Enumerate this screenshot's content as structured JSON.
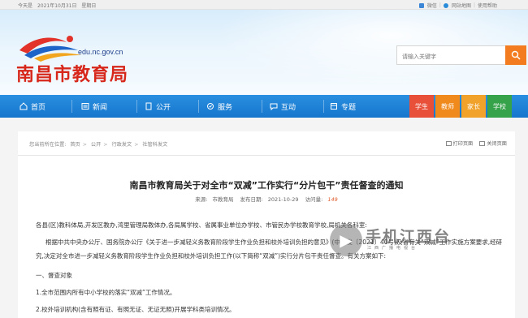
{
  "topbar": {
    "today_label": "今天是",
    "date": "2021年10月31日",
    "weekday": "星期日",
    "weibo": "微信",
    "sitemap": "网站地图",
    "help": "使用帮助"
  },
  "header": {
    "url": "edu.nc.gov.cn",
    "title": "南昌市教育局",
    "search_placeholder": "请输入关键字"
  },
  "nav": {
    "items": [
      "首页",
      "新闻",
      "公开",
      "服务",
      "互动",
      "专题"
    ],
    "roles": [
      "学生",
      "教师",
      "家长",
      "学校"
    ],
    "role_colors": [
      "#e8503a",
      "#f08a1c",
      "#f0a22a",
      "#36a24a"
    ]
  },
  "breadcrumb": {
    "prefix": "您当前所在位置:",
    "items": [
      "首页",
      "公开",
      "行政发文",
      "社管科发文"
    ]
  },
  "tools": {
    "print": "打印页面",
    "close": "关闭页面"
  },
  "article": {
    "title": "南昌市教育局关于对全市“双减”工作实行“分片包干”责任督查的通知",
    "source_label": "来源:",
    "source": "市教育局",
    "date_label": "发布日期:",
    "date": "2021-10-29",
    "hits_label": "访问量:",
    "hits": "149",
    "p1": "各县(区)教科体局,开发区教办,湾里管理局教体办,各局属学校、省属事业单位办学校、市管民办学校教育学校,局机关各科室:",
    "p2": "根据中共中央办公厅、国务院办公厅《关于进一步减轻义务教育阶段学生作业负担和校外培训负担的意见》(中办发〔2021〕40号)及省有关“双减”工作实施方案要求,经研究,决定对全市进一步减轻义务教育阶段学生作业负担和校外培训负担工作(以下简称“双减”)实行分片包干责任督查。有关方案如下:",
    "h1": "一、督查对象",
    "item1": "1.全市范围内所有中小学校的落实“双减”工作情况。",
    "item2": "2.校外培训机构(含有照有证、有照无证、无证无照)开展学科类培训情况。"
  },
  "watermark": {
    "text": "手机江西台",
    "sub": "江西广播电视台"
  }
}
